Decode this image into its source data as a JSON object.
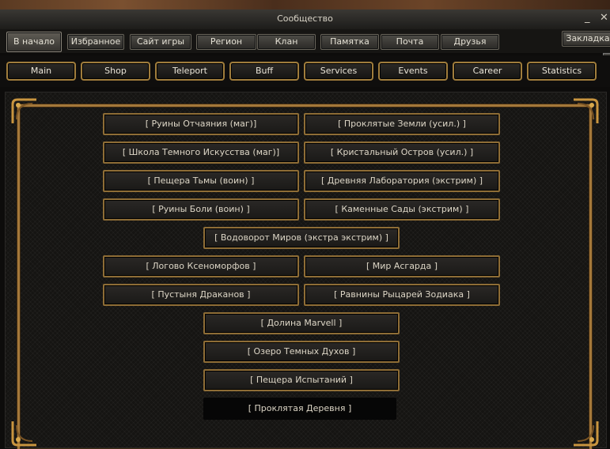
{
  "window": {
    "title": "Сообщество",
    "min_glyph": "_",
    "close_glyph": "✕"
  },
  "tabs": [
    "В начало",
    "Избранное",
    "Сайт игры",
    "Регион",
    "Клан",
    "Памятка",
    "Почта",
    "Друзья"
  ],
  "bookmark_tab": "Закладка",
  "nav": [
    "Main",
    "Shop",
    "Teleport",
    "Buff",
    "Services",
    "Events",
    "Career",
    "Statistics"
  ],
  "locations": [
    "[ Руины Отчаяния (маг)]",
    "[ Проклятые Земли (усил.) ]",
    "[ Школа Темного Искусства (маг)]",
    "[ Кристальный Остров (усил.) ]",
    "[ Пещера Тьмы (воин) ]",
    "[ Древняя Лаборатория (экстрим) ]",
    "[ Руины Боли (воин) ]",
    "[ Каменные Сады (экстрим) ]",
    "[ Водоворот Миров (экстра экстрим) ]",
    "[ Логово Ксеноморфов ]",
    "[ Мир Асгарда ]",
    "[ Пустыня Драканов ]",
    "[ Равнины Рыцарей Зодиака ]",
    "[ Долина Marvell ]",
    "[ Озеро Темных Духов ]",
    "[ Пещера Испытаний ]",
    "[ Проклятая Деревня ]"
  ],
  "colors": {
    "gold": "#a4783a",
    "button_border": "#8e6d36",
    "text": "#ddd6c6"
  }
}
